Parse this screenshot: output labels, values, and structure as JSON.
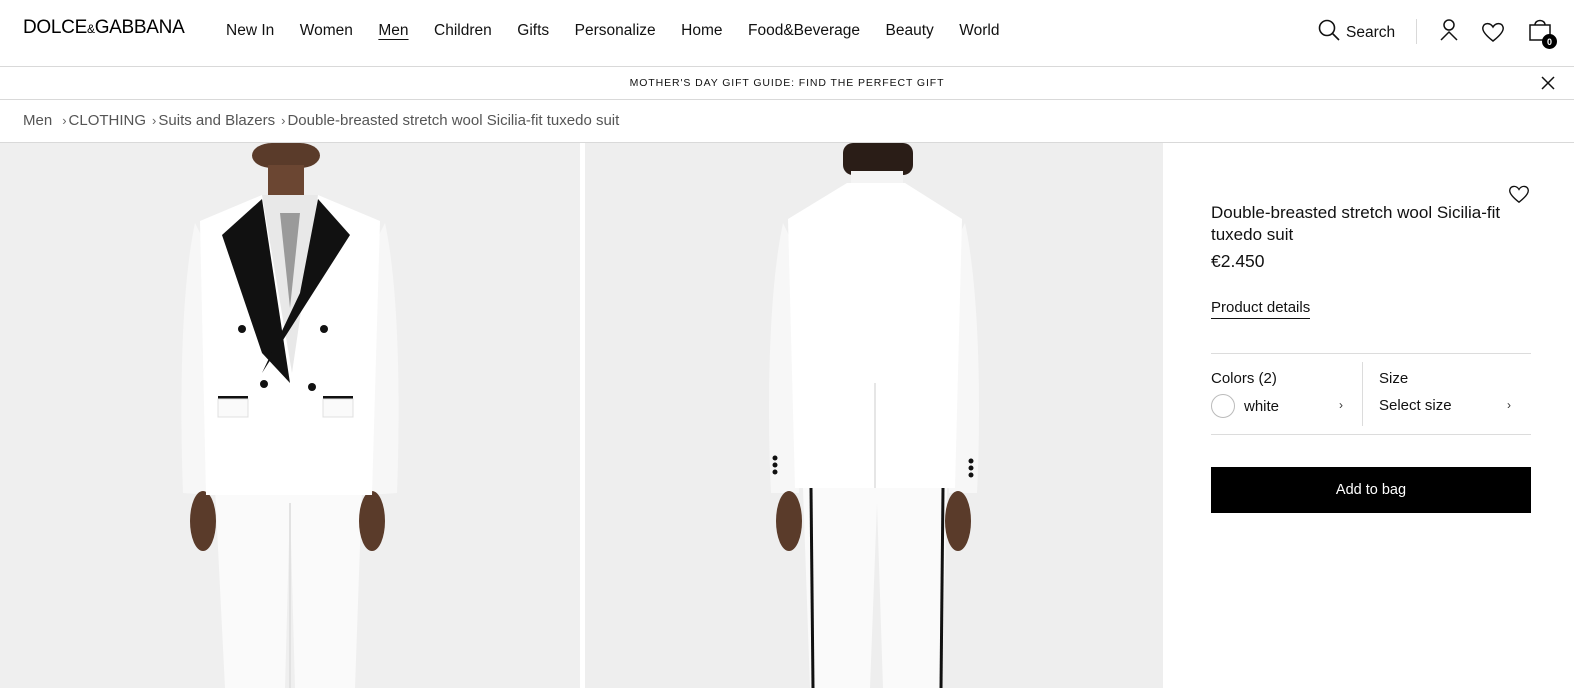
{
  "brand": {
    "logo_left": "DOLCE",
    "logo_amp": "&",
    "logo_right": "GABBANA"
  },
  "nav": {
    "items": [
      "New In",
      "Women",
      "Men",
      "Children",
      "Gifts",
      "Personalize",
      "Home",
      "Food&Beverage",
      "Beauty",
      "World"
    ],
    "active": "Men"
  },
  "header": {
    "search_label": "Search",
    "bag_count": "0",
    "icons": [
      "search-icon",
      "account-icon",
      "wishlist-heart-icon",
      "shopping-bag-icon"
    ]
  },
  "promo": {
    "text": "MOTHER'S DAY GIFT GUIDE: FIND THE PERFECT GIFT"
  },
  "breadcrumb": [
    "Men",
    "CLOTHING",
    "Suits and Blazers",
    "Double-breasted stretch wool Sicilia-fit tuxedo suit"
  ],
  "product": {
    "title": "Double-breasted stretch wool Sicilia-fit tuxedo suit",
    "price": "€2.450",
    "details_link": "Product details",
    "colors_label": "Colors (2)",
    "color_value": "white",
    "size_label": "Size",
    "size_value": "Select size",
    "add_to_bag": "Add to bag"
  },
  "colors": {
    "accent": "#000000",
    "image_bg": "#efefef",
    "border": "#d9d9d9"
  }
}
